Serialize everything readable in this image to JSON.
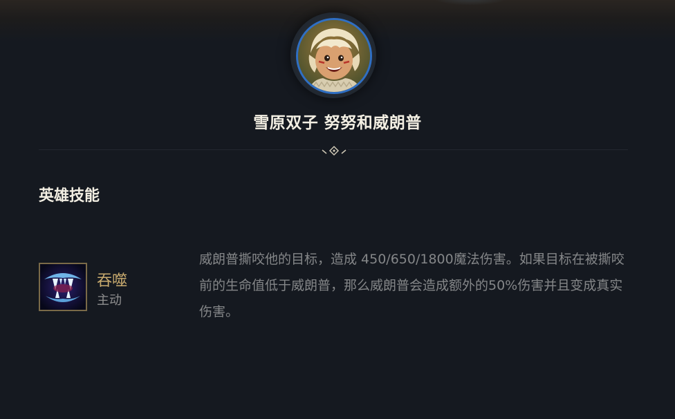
{
  "champion": {
    "name": "雪原双子 努努和威朗普",
    "portrait": "nunu-willump-portrait"
  },
  "section": {
    "title": "英雄技能"
  },
  "ability": {
    "name": "吞噬",
    "type": "主动",
    "icon": "fang-bite-icon",
    "description": "威朗普撕咬他的目标，造成 450/650/1800魔法伤害。如果目标在被撕咬前的生命值低于威朗普，那么威朗普会造成额外的50%伤害并且变成真实伤害。"
  },
  "colors": {
    "background": "#151920",
    "title": "#f3efe3",
    "ability_name": "#c8aa6e",
    "description": "#848688",
    "avatar_ring": "#2f6fc4"
  }
}
